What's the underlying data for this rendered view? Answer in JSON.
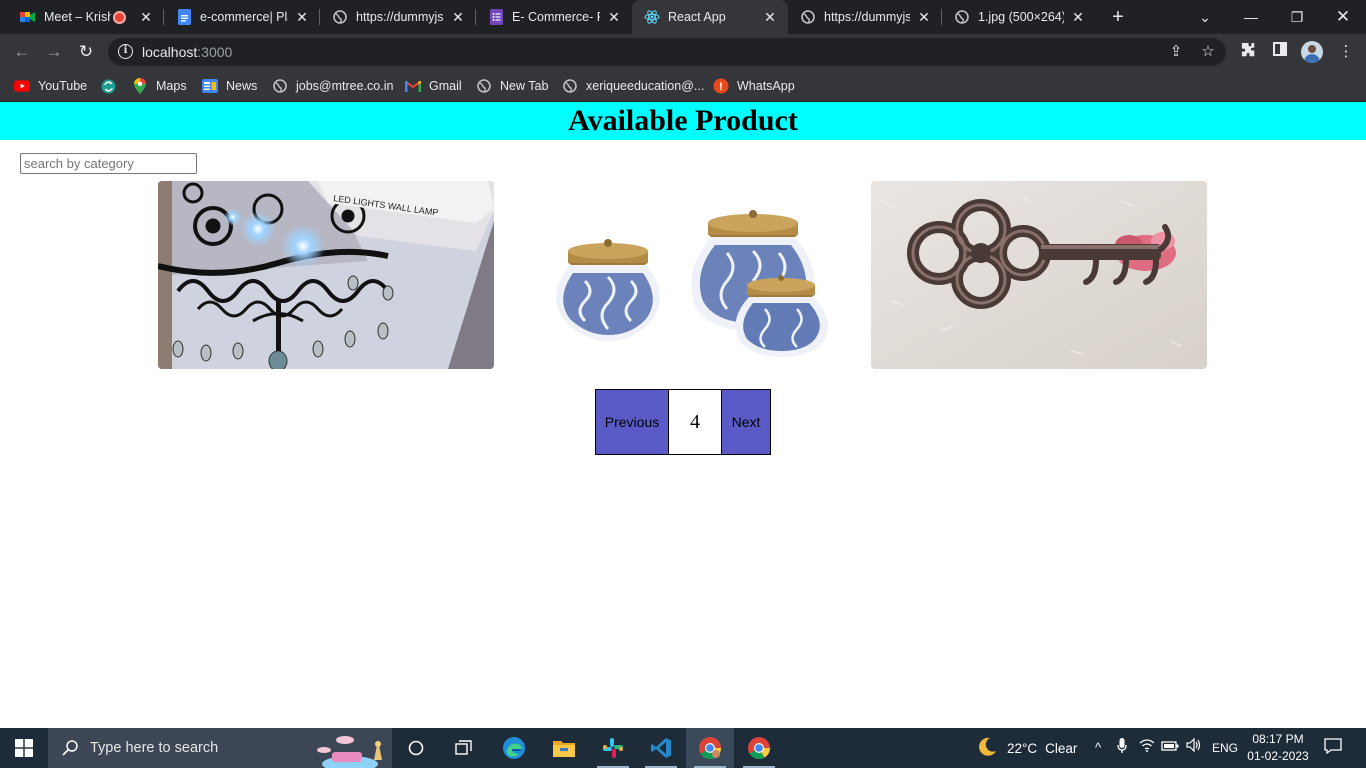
{
  "browser": {
    "tabs": [
      {
        "title": "Meet – Krishna",
        "icon": "google-meet-icon",
        "recording": true
      },
      {
        "title": "e-commerce| Planning",
        "icon": "google-docs-icon"
      },
      {
        "title": "https://dummyjson.com",
        "icon": "globe-icon"
      },
      {
        "title": "E- Commerce- Fr",
        "icon": "google-forms-icon"
      },
      {
        "title": "React App",
        "icon": "react-icon",
        "active": true
      },
      {
        "title": "https://dummyjson.com",
        "icon": "globe-icon"
      },
      {
        "title": "1.jpg (500×264)",
        "icon": "globe-icon"
      }
    ],
    "url_host": "localhost",
    "url_port": ":3000",
    "bookmarks": [
      {
        "label": "YouTube",
        "icon": "youtube-icon"
      },
      {
        "label": "",
        "icon": "sync-icon"
      },
      {
        "label": "Maps",
        "icon": "google-maps-icon"
      },
      {
        "label": "News",
        "icon": "google-news-icon"
      },
      {
        "label": "jobs@mtree.co.in",
        "icon": "globe-icon"
      },
      {
        "label": "Gmail",
        "icon": "gmail-icon"
      },
      {
        "label": "New Tab",
        "icon": "globe-icon"
      },
      {
        "label": "xeriqueeducation@...",
        "icon": "globe-icon"
      },
      {
        "label": "WhatsApp",
        "icon": "whatsapp-icon"
      }
    ]
  },
  "page": {
    "heading": "Available Product",
    "search": {
      "placeholder": "search by category",
      "value": ""
    },
    "products": [
      {
        "image": "led-wall-lamp-image",
        "image_text": "LED LIGHTS WALL LAMP"
      },
      {
        "image": "ceramic-jars-image"
      },
      {
        "image": "key-holder-image"
      }
    ],
    "pagination": {
      "previous_label": "Previous",
      "page": "4",
      "next_label": "Next"
    }
  },
  "taskbar": {
    "search_placeholder": "Type here to search",
    "weather_temp": "22°C",
    "weather_desc": "Clear",
    "language": "ENG",
    "time": "08:17 PM",
    "date": "01-02-2023"
  },
  "colors": {
    "banner": "#00ffff",
    "pager_button": "#5b5bc8",
    "browser_frame": "#35363a",
    "taskbar": "#1e2b38"
  }
}
